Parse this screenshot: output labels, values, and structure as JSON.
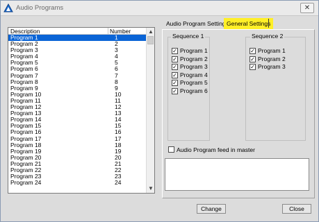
{
  "window": {
    "title": "Audio Programs",
    "close_glyph": "✕"
  },
  "list": {
    "columns": {
      "description": "Description",
      "number": "Number"
    },
    "selected_index": 0,
    "rows": [
      {
        "description": "Program 1",
        "number": "1"
      },
      {
        "description": "Program 2",
        "number": "2"
      },
      {
        "description": "Program 3",
        "number": "3"
      },
      {
        "description": "Program 4",
        "number": "4"
      },
      {
        "description": "Program 5",
        "number": "5"
      },
      {
        "description": "Program 6",
        "number": "6"
      },
      {
        "description": "Program 7",
        "number": "7"
      },
      {
        "description": "Program 8",
        "number": "8"
      },
      {
        "description": "Program 9",
        "number": "9"
      },
      {
        "description": "Program 10",
        "number": "10"
      },
      {
        "description": "Program 11",
        "number": "11"
      },
      {
        "description": "Program 12",
        "number": "12"
      },
      {
        "description": "Program 13",
        "number": "13"
      },
      {
        "description": "Program 14",
        "number": "14"
      },
      {
        "description": "Program 15",
        "number": "15"
      },
      {
        "description": "Program 16",
        "number": "16"
      },
      {
        "description": "Program 17",
        "number": "17"
      },
      {
        "description": "Program 18",
        "number": "18"
      },
      {
        "description": "Program 19",
        "number": "19"
      },
      {
        "description": "Program 20",
        "number": "20"
      },
      {
        "description": "Program 21",
        "number": "21"
      },
      {
        "description": "Program 22",
        "number": "22"
      },
      {
        "description": "Program 23",
        "number": "23"
      },
      {
        "description": "Program 24",
        "number": "24"
      }
    ]
  },
  "tabs": [
    {
      "label": "Audio Program Settings",
      "active": false
    },
    {
      "label": "General Settings",
      "active": true
    }
  ],
  "sequence1": {
    "title": "Sequence 1",
    "items": [
      {
        "label": "Program 1",
        "checked": true
      },
      {
        "label": "Program 2",
        "checked": true
      },
      {
        "label": "Program 3",
        "checked": true
      },
      {
        "label": "Program 4",
        "checked": true
      },
      {
        "label": "Program 5",
        "checked": true
      },
      {
        "label": "Program 6",
        "checked": true
      }
    ]
  },
  "sequence2": {
    "title": "Sequence 2",
    "items": [
      {
        "label": "Program 1",
        "checked": true
      },
      {
        "label": "Program 2",
        "checked": true
      },
      {
        "label": "Program 3",
        "checked": true
      }
    ]
  },
  "feed_in_master": {
    "label": "Audio Program feed in master",
    "checked": false
  },
  "buttons": {
    "change": "Change",
    "close": "Close"
  },
  "colors": {
    "highlight": "#ffef27",
    "selection": "#0a64d6"
  }
}
